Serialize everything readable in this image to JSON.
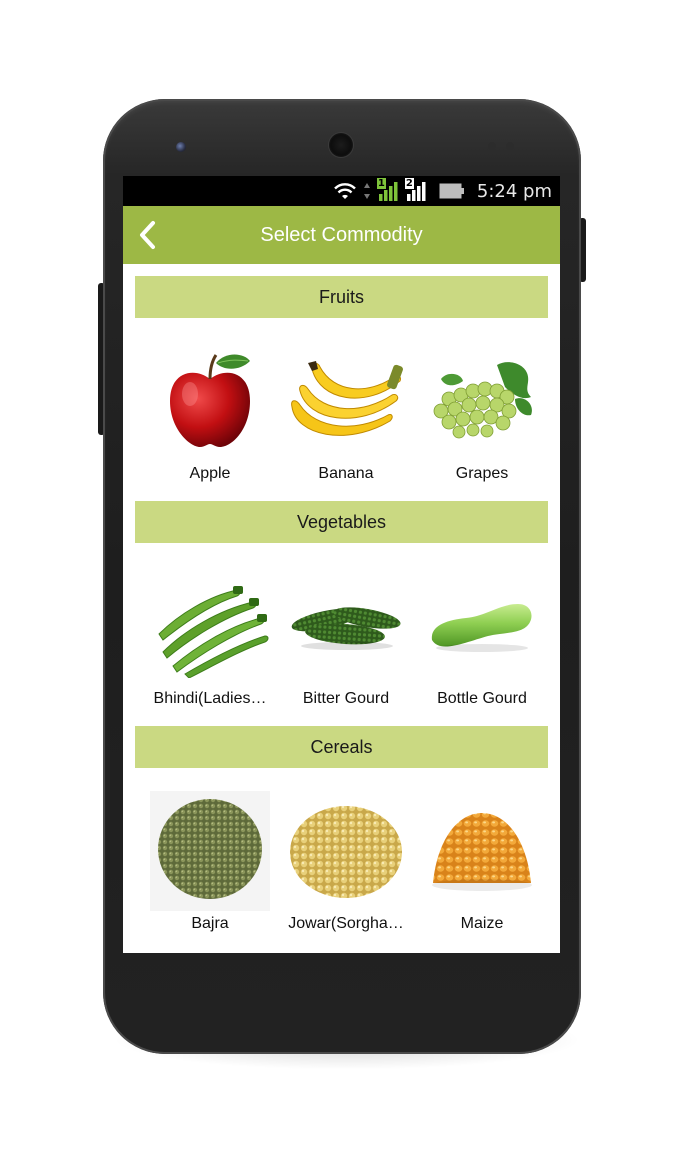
{
  "status_bar": {
    "time": "5:24 pm",
    "sim1": "1",
    "sim2": "2",
    "icons": [
      "wifi-icon",
      "data-arrows-icon",
      "signal-sim1-icon",
      "signal-sim2-icon",
      "battery-icon"
    ]
  },
  "app_bar": {
    "title": "Select Commodity",
    "back_icon": "chevron-left-icon",
    "color": "#9db845"
  },
  "accent_colors": {
    "section_header_bg": "#cad982"
  },
  "sections": [
    {
      "title": "Fruits",
      "items": [
        {
          "label": "Apple",
          "icon": "apple-image"
        },
        {
          "label": "Banana",
          "icon": "banana-image"
        },
        {
          "label": "Grapes",
          "icon": "grapes-image"
        }
      ]
    },
    {
      "title": "Vegetables",
      "items": [
        {
          "label": "Bhindi(Ladies…",
          "icon": "okra-image"
        },
        {
          "label": "Bitter Gourd",
          "icon": "bitter-gourd-image"
        },
        {
          "label": "Bottle Gourd",
          "icon": "bottle-gourd-image"
        }
      ]
    },
    {
      "title": "Cereals",
      "items": [
        {
          "label": "Bajra",
          "icon": "millet-image"
        },
        {
          "label": "Jowar(Sorgha…",
          "icon": "sorghum-image"
        },
        {
          "label": "Maize",
          "icon": "maize-image"
        }
      ]
    }
  ]
}
